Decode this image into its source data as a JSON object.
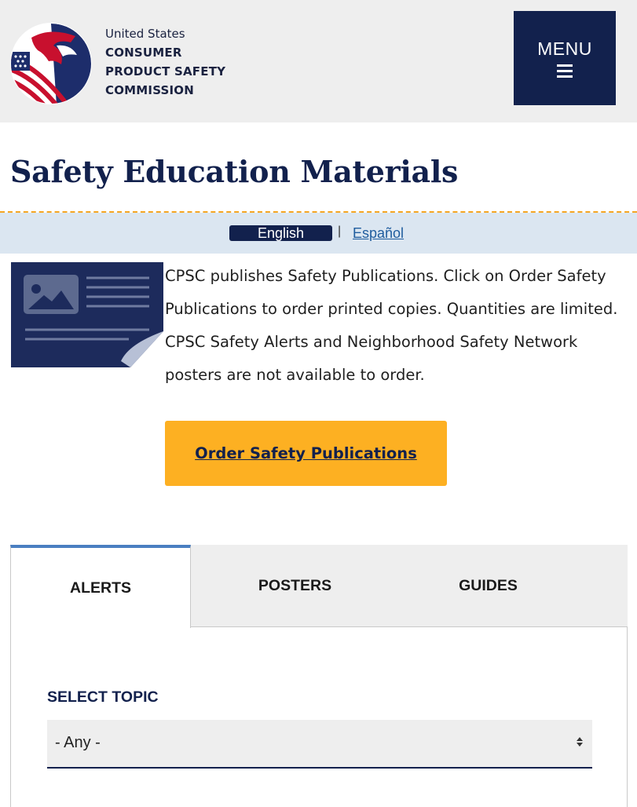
{
  "header": {
    "agency_line1": "United States",
    "agency_line2": "CONSUMER",
    "agency_line3": "PRODUCT SAFETY",
    "agency_line4": "COMMISSION",
    "menu_label": "MENU"
  },
  "page": {
    "title": "Safety Education Materials"
  },
  "language": {
    "current": "English",
    "separator": "|",
    "alternate": "Español"
  },
  "intro": {
    "text": "CPSC publishes Safety Publications. Click on Order Safety Publications to order printed copies. Quantities are limited. CPSC Safety Alerts and Neighborhood Safety Network posters are not available to order.",
    "order_button": "Order Safety Publications"
  },
  "tabs": [
    {
      "label": "ALERTS",
      "active": true
    },
    {
      "label": "POSTERS",
      "active": false
    },
    {
      "label": "GUIDES",
      "active": false
    }
  ],
  "filter": {
    "label": "SELECT TOPIC",
    "selected": "- Any -"
  },
  "colors": {
    "navy": "#12214d",
    "accent_yellow": "#fdb022",
    "lang_bar": "#dbe6f1",
    "tab_active_border": "#4a7fc1"
  },
  "icons": [
    "cpsc-eagle-logo",
    "publication-icon",
    "hamburger-icon",
    "select-arrows-icon"
  ]
}
